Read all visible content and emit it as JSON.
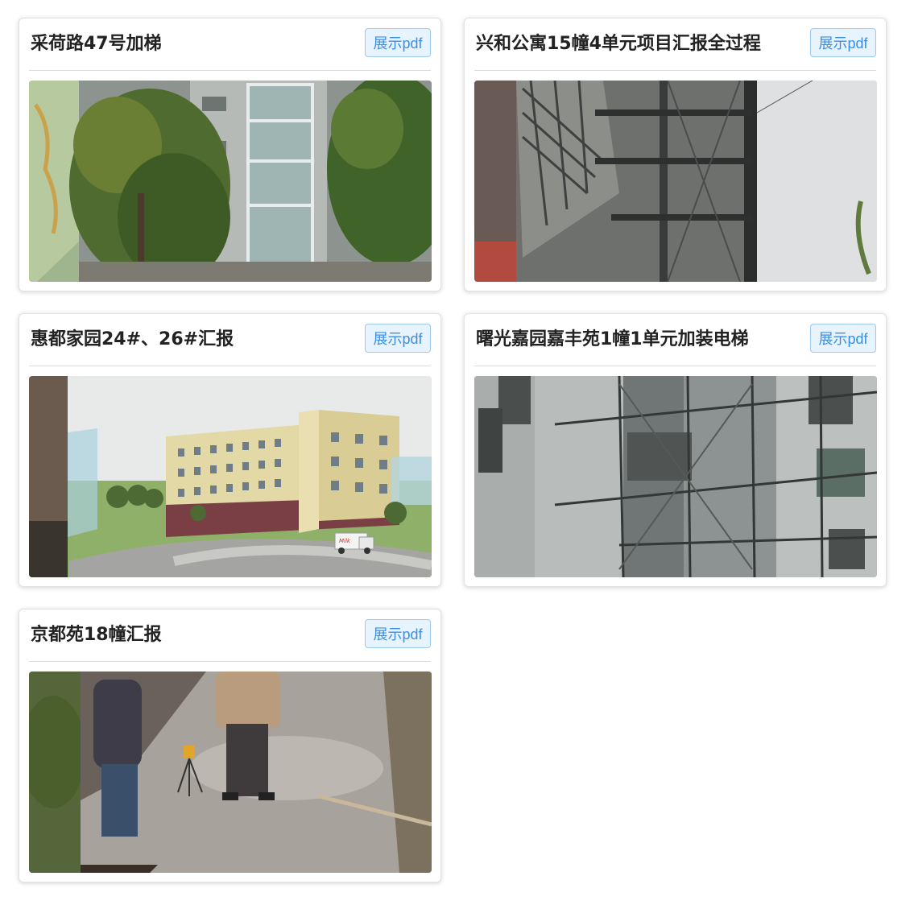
{
  "cards": [
    {
      "title": "采荷路47号加梯",
      "button_label": "展示pdf",
      "image": "elevator-shaft-trees-photo"
    },
    {
      "title": "兴和公寓15幢4单元项目汇报全过程",
      "button_label": "展示pdf",
      "image": "steel-frame-elevator-photo"
    },
    {
      "title": "惠都家园24#、26#汇报",
      "button_label": "展示pdf",
      "image": "residential-building-render"
    },
    {
      "title": "曙光嘉园嘉丰苑1幢1单元加装电梯",
      "button_label": "展示pdf",
      "image": "scaffolding-elevator-photo"
    },
    {
      "title": "京都苑18幢汇报",
      "button_label": "展示pdf",
      "image": "workers-site-level-photo"
    }
  ]
}
